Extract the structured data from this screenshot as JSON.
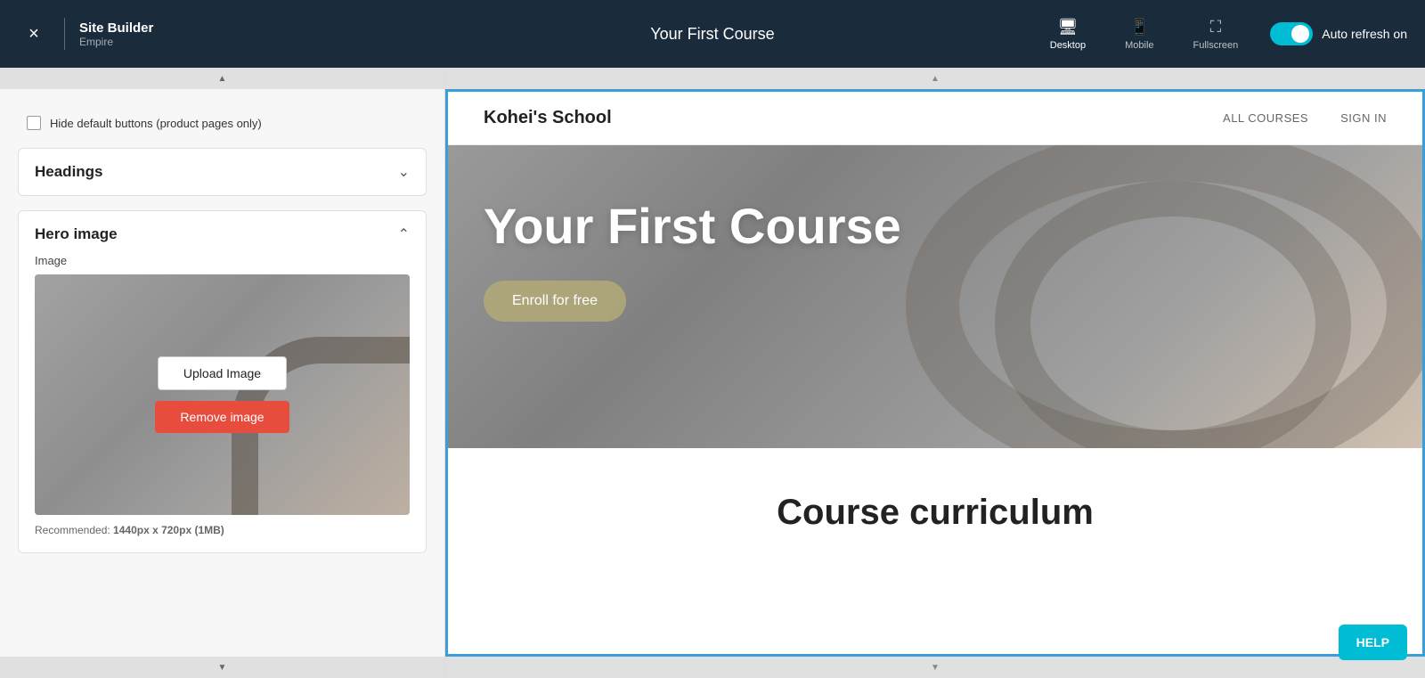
{
  "topbar": {
    "close_label": "×",
    "app_title": "Site Builder",
    "app_sub": "Empire",
    "page_title": "Your First Course",
    "view_desktop": "Desktop",
    "view_mobile": "Mobile",
    "view_fullscreen": "Fullscreen",
    "auto_refresh_label": "Auto refresh on"
  },
  "left_panel": {
    "checkbox_label": "Hide default buttons (product pages only)",
    "headings_title": "Headings",
    "hero_image_title": "Hero image",
    "image_label": "Image",
    "upload_btn": "Upload Image",
    "remove_btn": "Remove image",
    "recommended": "Recommended: ",
    "recommended_size": "1440px x 720px (1MB)"
  },
  "preview": {
    "site_name": "Kohei's School",
    "nav_all_courses": "ALL COURSES",
    "nav_sign_in": "SIGN IN",
    "course_title": "Your First Course",
    "enroll_btn": "Enroll for free",
    "curriculum_title": "Course curriculum",
    "help_btn": "HELP"
  }
}
